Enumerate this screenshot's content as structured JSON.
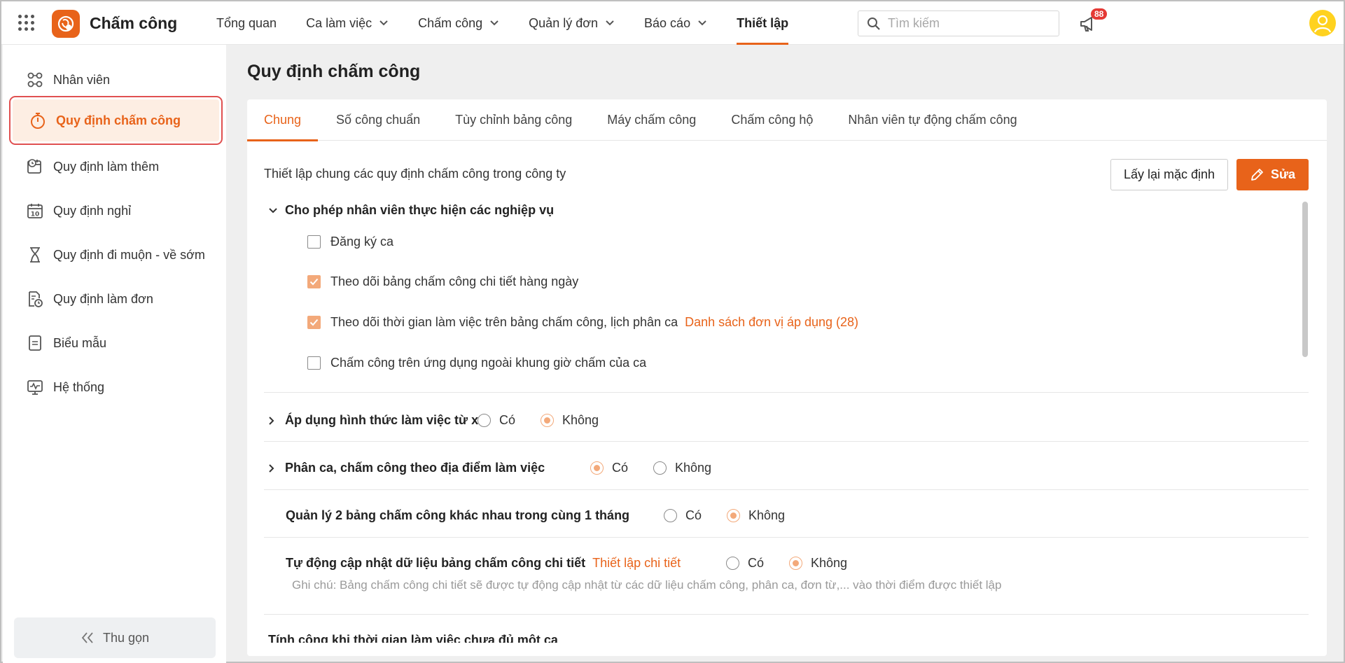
{
  "app": {
    "title": "Chấm công"
  },
  "nav": [
    {
      "label": "Tổng quan",
      "dropdown": false
    },
    {
      "label": "Ca làm việc",
      "dropdown": true
    },
    {
      "label": "Chấm công",
      "dropdown": true
    },
    {
      "label": "Quản lý đơn",
      "dropdown": true
    },
    {
      "label": "Báo cáo",
      "dropdown": true
    },
    {
      "label": "Thiết lập",
      "dropdown": false,
      "active": true
    }
  ],
  "search": {
    "placeholder": "Tìm kiếm"
  },
  "notifications": {
    "count": "88"
  },
  "sidebar": {
    "items": [
      {
        "label": "Nhân viên",
        "icon": "users-icon"
      },
      {
        "label": "Quy định chấm công",
        "icon": "stopwatch-icon",
        "active": true
      },
      {
        "label": "Quy định làm thêm",
        "icon": "calendar-clock-icon"
      },
      {
        "label": "Quy định nghỉ",
        "icon": "calendar-10-icon"
      },
      {
        "label": "Quy định đi muộn - về sớm",
        "icon": "hourglass-icon"
      },
      {
        "label": "Quy định làm đơn",
        "icon": "document-clock-icon"
      },
      {
        "label": "Biểu mẫu",
        "icon": "form-icon"
      },
      {
        "label": "Hệ thống",
        "icon": "monitor-pulse-icon"
      }
    ],
    "collapse_label": "Thu gọn"
  },
  "page": {
    "title": "Quy định chấm công"
  },
  "tabs": [
    "Chung",
    "Số công chuẩn",
    "Tùy chỉnh bảng công",
    "Máy chấm công",
    "Chấm công hộ",
    "Nhân viên tự động chấm công"
  ],
  "content": {
    "description": "Thiết lập chung các quy định chấm công trong công ty",
    "reset_label": "Lấy lại mặc định",
    "edit_label": "Sửa",
    "section1": {
      "title": "Cho phép nhân viên thực hiện các nghiệp vụ",
      "checks": [
        {
          "label": "Đăng ký ca",
          "checked": false
        },
        {
          "label": "Theo dõi bảng chấm công chi tiết hàng ngày",
          "checked": true
        },
        {
          "label": "Theo dõi thời gian làm việc trên bảng chấm công, lịch phân ca",
          "checked": true,
          "link": "Danh sách đơn vị áp dụng (28)"
        },
        {
          "label": "Chấm công trên ứng dụng ngoài khung giờ chấm của ca",
          "checked": false
        }
      ]
    },
    "options": [
      {
        "label": "Áp dụng hình thức làm việc từ xa",
        "yes": "Có",
        "no": "Không",
        "selected": "no"
      },
      {
        "label": "Phân ca, chấm công theo địa điểm làm việc",
        "yes": "Có",
        "no": "Không",
        "selected": "yes"
      },
      {
        "label": "Quản lý 2 bảng chấm công khác nhau trong cùng 1 tháng",
        "yes": "Có",
        "no": "Không",
        "selected": "no"
      },
      {
        "label": "Tự động cập nhật dữ liệu bảng chấm công chi tiết",
        "link": "Thiết lập chi tiết",
        "yes": "Có",
        "no": "Không",
        "selected": "no"
      }
    ],
    "note": "Ghi chú: Bảng chấm công chi tiết sẽ được tự động cập nhật từ các dữ liệu chấm công, phân ca, đơn từ,... vào thời điểm được thiết lập",
    "next_section": "Tính công khi thời gian làm việc chưa đủ một ca"
  },
  "colors": {
    "accent": "#e8631a",
    "accent_light": "#fdeee3",
    "check": "#f3a97a"
  }
}
